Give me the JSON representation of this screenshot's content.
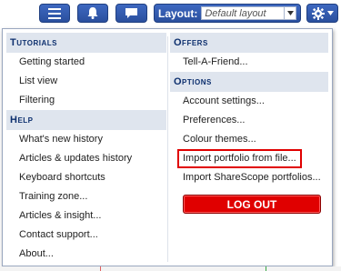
{
  "topbar": {
    "layout_label": "Layout:",
    "layout_value": "Default layout",
    "icons": [
      "list-icon",
      "bell-icon",
      "chat-icon",
      "gear-icon"
    ]
  },
  "menu": {
    "tutorials_head": "Tutorials",
    "tutorials": [
      "Getting started",
      "List view",
      "Filtering"
    ],
    "help_head": "Help",
    "help": [
      "What's new history",
      "Articles & updates history",
      "Keyboard shortcuts",
      "Training zone...",
      "Articles & insight...",
      "Contact support...",
      "About..."
    ],
    "offers_head": "Offers",
    "offers": [
      "Tell-A-Friend..."
    ],
    "options_head": "Options",
    "options": [
      "Account settings...",
      "Preferences...",
      "Colour themes...",
      "Import portfolio from file...",
      "Import ShareScope portfolios..."
    ],
    "logout_label": "LOG OUT"
  },
  "colors": {
    "accent": "#2a4f9e",
    "header_bg": "#dfe5ee",
    "header_text": "#0d2f6e",
    "logout": "#e00000",
    "highlight_border": "#e00000"
  }
}
